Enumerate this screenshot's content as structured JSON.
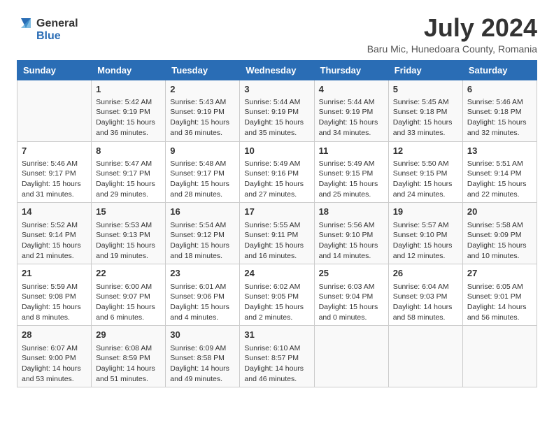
{
  "header": {
    "logo_general": "General",
    "logo_blue": "Blue",
    "title": "July 2024",
    "subtitle": "Baru Mic, Hunedoara County, Romania"
  },
  "calendar": {
    "days_of_week": [
      "Sunday",
      "Monday",
      "Tuesday",
      "Wednesday",
      "Thursday",
      "Friday",
      "Saturday"
    ],
    "weeks": [
      [
        {
          "day": "",
          "info": ""
        },
        {
          "day": "1",
          "info": "Sunrise: 5:42 AM\nSunset: 9:19 PM\nDaylight: 15 hours\nand 36 minutes."
        },
        {
          "day": "2",
          "info": "Sunrise: 5:43 AM\nSunset: 9:19 PM\nDaylight: 15 hours\nand 36 minutes."
        },
        {
          "day": "3",
          "info": "Sunrise: 5:44 AM\nSunset: 9:19 PM\nDaylight: 15 hours\nand 35 minutes."
        },
        {
          "day": "4",
          "info": "Sunrise: 5:44 AM\nSunset: 9:19 PM\nDaylight: 15 hours\nand 34 minutes."
        },
        {
          "day": "5",
          "info": "Sunrise: 5:45 AM\nSunset: 9:18 PM\nDaylight: 15 hours\nand 33 minutes."
        },
        {
          "day": "6",
          "info": "Sunrise: 5:46 AM\nSunset: 9:18 PM\nDaylight: 15 hours\nand 32 minutes."
        }
      ],
      [
        {
          "day": "7",
          "info": "Sunrise: 5:46 AM\nSunset: 9:17 PM\nDaylight: 15 hours\nand 31 minutes."
        },
        {
          "day": "8",
          "info": "Sunrise: 5:47 AM\nSunset: 9:17 PM\nDaylight: 15 hours\nand 29 minutes."
        },
        {
          "day": "9",
          "info": "Sunrise: 5:48 AM\nSunset: 9:17 PM\nDaylight: 15 hours\nand 28 minutes."
        },
        {
          "day": "10",
          "info": "Sunrise: 5:49 AM\nSunset: 9:16 PM\nDaylight: 15 hours\nand 27 minutes."
        },
        {
          "day": "11",
          "info": "Sunrise: 5:49 AM\nSunset: 9:15 PM\nDaylight: 15 hours\nand 25 minutes."
        },
        {
          "day": "12",
          "info": "Sunrise: 5:50 AM\nSunset: 9:15 PM\nDaylight: 15 hours\nand 24 minutes."
        },
        {
          "day": "13",
          "info": "Sunrise: 5:51 AM\nSunset: 9:14 PM\nDaylight: 15 hours\nand 22 minutes."
        }
      ],
      [
        {
          "day": "14",
          "info": "Sunrise: 5:52 AM\nSunset: 9:14 PM\nDaylight: 15 hours\nand 21 minutes."
        },
        {
          "day": "15",
          "info": "Sunrise: 5:53 AM\nSunset: 9:13 PM\nDaylight: 15 hours\nand 19 minutes."
        },
        {
          "day": "16",
          "info": "Sunrise: 5:54 AM\nSunset: 9:12 PM\nDaylight: 15 hours\nand 18 minutes."
        },
        {
          "day": "17",
          "info": "Sunrise: 5:55 AM\nSunset: 9:11 PM\nDaylight: 15 hours\nand 16 minutes."
        },
        {
          "day": "18",
          "info": "Sunrise: 5:56 AM\nSunset: 9:10 PM\nDaylight: 15 hours\nand 14 minutes."
        },
        {
          "day": "19",
          "info": "Sunrise: 5:57 AM\nSunset: 9:10 PM\nDaylight: 15 hours\nand 12 minutes."
        },
        {
          "day": "20",
          "info": "Sunrise: 5:58 AM\nSunset: 9:09 PM\nDaylight: 15 hours\nand 10 minutes."
        }
      ],
      [
        {
          "day": "21",
          "info": "Sunrise: 5:59 AM\nSunset: 9:08 PM\nDaylight: 15 hours\nand 8 minutes."
        },
        {
          "day": "22",
          "info": "Sunrise: 6:00 AM\nSunset: 9:07 PM\nDaylight: 15 hours\nand 6 minutes."
        },
        {
          "day": "23",
          "info": "Sunrise: 6:01 AM\nSunset: 9:06 PM\nDaylight: 15 hours\nand 4 minutes."
        },
        {
          "day": "24",
          "info": "Sunrise: 6:02 AM\nSunset: 9:05 PM\nDaylight: 15 hours\nand 2 minutes."
        },
        {
          "day": "25",
          "info": "Sunrise: 6:03 AM\nSunset: 9:04 PM\nDaylight: 15 hours\nand 0 minutes."
        },
        {
          "day": "26",
          "info": "Sunrise: 6:04 AM\nSunset: 9:03 PM\nDaylight: 14 hours\nand 58 minutes."
        },
        {
          "day": "27",
          "info": "Sunrise: 6:05 AM\nSunset: 9:01 PM\nDaylight: 14 hours\nand 56 minutes."
        }
      ],
      [
        {
          "day": "28",
          "info": "Sunrise: 6:07 AM\nSunset: 9:00 PM\nDaylight: 14 hours\nand 53 minutes."
        },
        {
          "day": "29",
          "info": "Sunrise: 6:08 AM\nSunset: 8:59 PM\nDaylight: 14 hours\nand 51 minutes."
        },
        {
          "day": "30",
          "info": "Sunrise: 6:09 AM\nSunset: 8:58 PM\nDaylight: 14 hours\nand 49 minutes."
        },
        {
          "day": "31",
          "info": "Sunrise: 6:10 AM\nSunset: 8:57 PM\nDaylight: 14 hours\nand 46 minutes."
        },
        {
          "day": "",
          "info": ""
        },
        {
          "day": "",
          "info": ""
        },
        {
          "day": "",
          "info": ""
        }
      ]
    ]
  }
}
